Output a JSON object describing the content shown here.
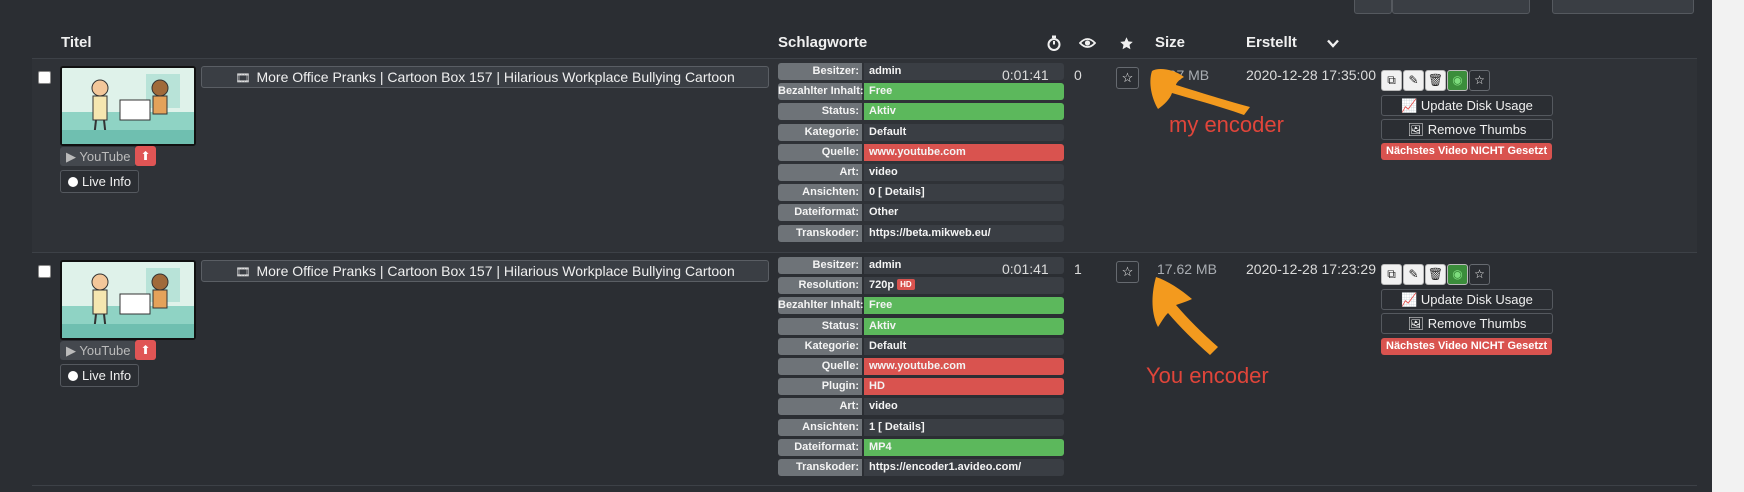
{
  "header": {
    "titel": "Titel",
    "schlagworte": "Schlagworte",
    "size": "Size",
    "erstellt": "Erstellt"
  },
  "rows": [
    {
      "title": "More Office Pranks | Cartoon Box 157 | Hilarious Workplace Bullying Cartoon",
      "youtube_label": "YouTube",
      "live_info_label": "Live Info",
      "tags": [
        {
          "key": "Besitzer:",
          "value": "admin",
          "style": "plain"
        },
        {
          "key": "Bezahlter Inhalt:",
          "value": "Free",
          "style": "green"
        },
        {
          "key": "Status:",
          "value": "Aktiv",
          "style": "green"
        },
        {
          "key": "Kategorie:",
          "value": "Default",
          "style": "plain"
        },
        {
          "key": "Quelle:",
          "value": "www.youtube.com",
          "style": "red"
        },
        {
          "key": "Art:",
          "value": "video",
          "style": "plain"
        },
        {
          "key": "Ansichten:",
          "value": "0 [ Details]",
          "style": "plain"
        },
        {
          "key": "Dateiformat:",
          "value": "Other",
          "style": "plain"
        },
        {
          "key": "Transkoder:",
          "value": "https://beta.mikweb.eu/",
          "style": "plain"
        }
      ],
      "duration": "0:01:41",
      "views": "0",
      "size": "1.07 MB",
      "created": "2020-12-28 17:35:00",
      "update_disk_usage": "Update Disk Usage",
      "remove_thumbs": "Remove Thumbs",
      "next_video_warning": "Nächstes Video NICHT Gesetzt",
      "annotation": "my encoder"
    },
    {
      "title": "More Office Pranks | Cartoon Box 157 | Hilarious Workplace Bullying Cartoon",
      "youtube_label": "YouTube",
      "live_info_label": "Live Info",
      "tags": [
        {
          "key": "Besitzer:",
          "value": "admin",
          "style": "plain"
        },
        {
          "key": "Resolution:",
          "value": "720p",
          "style": "plain",
          "badge": "HD"
        },
        {
          "key": "Bezahlter Inhalt:",
          "value": "Free",
          "style": "green"
        },
        {
          "key": "Status:",
          "value": "Aktiv",
          "style": "green"
        },
        {
          "key": "Kategorie:",
          "value": "Default",
          "style": "plain"
        },
        {
          "key": "Quelle:",
          "value": "www.youtube.com",
          "style": "red"
        },
        {
          "key": "Plugin:",
          "value": "HD",
          "style": "red"
        },
        {
          "key": "Art:",
          "value": "video",
          "style": "plain"
        },
        {
          "key": "Ansichten:",
          "value": "1 [ Details]",
          "style": "plain"
        },
        {
          "key": "Dateiformat:",
          "value": "MP4",
          "style": "green"
        },
        {
          "key": "Transkoder:",
          "value": "https://encoder1.avideo.com/",
          "style": "plain"
        }
      ],
      "duration": "0:01:41",
      "views": "1",
      "size": "17.62 MB",
      "created": "2020-12-28 17:23:29",
      "update_disk_usage": "Update Disk Usage",
      "remove_thumbs": "Remove Thumbs",
      "next_video_warning": "Nächstes Video NICHT Gesetzt",
      "annotation": "You encoder"
    }
  ],
  "colors": {
    "background": "#2b2e33",
    "tag_key": "#6e7378",
    "green": "#5cb85c",
    "red": "#d9534f",
    "annotation": "#e0453a",
    "arrow": "#f39a1e"
  },
  "icons": {
    "duration": "stopwatch-icon",
    "views": "eye-icon",
    "favorite": "star-icon",
    "sort": "chevron-down-icon"
  }
}
